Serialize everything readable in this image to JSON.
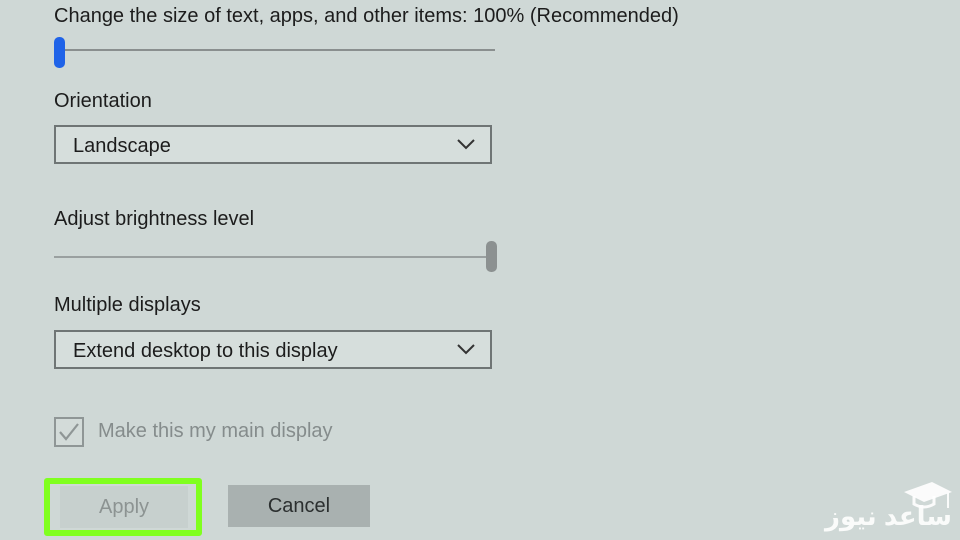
{
  "scale": {
    "label": "Change the size of text, apps, and other items: 100% (Recommended)",
    "slider_value_fraction": 0.0
  },
  "orientation": {
    "label": "Orientation",
    "value": "Landscape"
  },
  "brightness": {
    "label": "Adjust brightness level",
    "slider_value_fraction": 1.0
  },
  "multiple_displays": {
    "label": "Multiple displays",
    "value": "Extend desktop to this display"
  },
  "main_display": {
    "label": "Make this my main display",
    "checked": true
  },
  "buttons": {
    "apply": "Apply",
    "cancel": "Cancel"
  },
  "watermark": {
    "text": "ساعد نیوز",
    "icon": "graduation-cap-icon"
  },
  "colors": {
    "background": "#cfd8d6",
    "accent_slider": "#1f63e8",
    "highlight": "#80ff1f"
  }
}
